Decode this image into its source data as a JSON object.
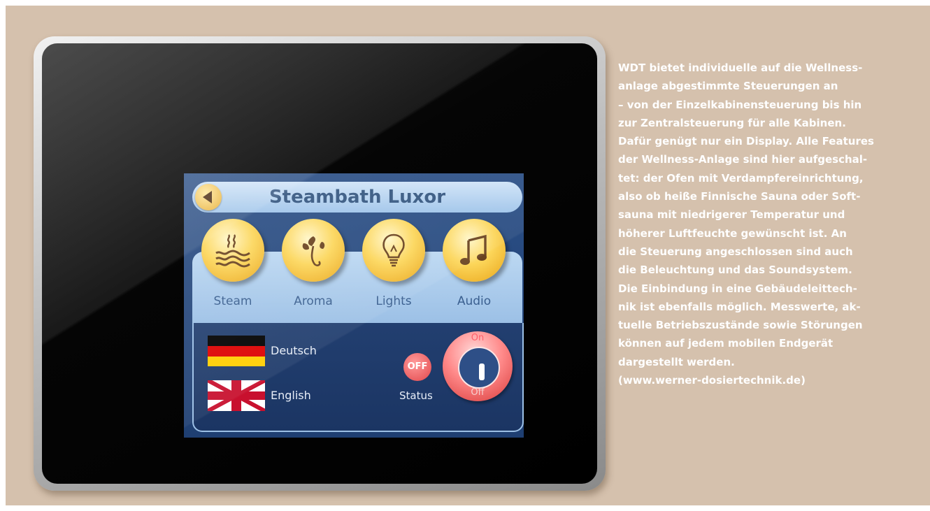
{
  "device": {
    "title": "Steambath Luxor",
    "features": [
      {
        "label": "Steam",
        "icon": "steam-icon"
      },
      {
        "label": "Aroma",
        "icon": "aroma-icon"
      },
      {
        "label": "Lights",
        "icon": "lightbulb-icon"
      },
      {
        "label": "Audio",
        "icon": "music-icon"
      }
    ],
    "languages": [
      {
        "label": "Deutsch",
        "icon": "german-flag-icon"
      },
      {
        "label": "English",
        "icon": "uk-flag-icon"
      }
    ],
    "status_badge": "OFF",
    "status_label": "Status",
    "power": {
      "on_label": "On",
      "off_label": "Off",
      "icon": "power-icon"
    }
  },
  "article": {
    "lines": [
      "WDT bietet individuelle auf die Wellness-",
      "anlage abgestimmte Steuerungen an",
      "– von der Einzelkabinensteuerung bis hin",
      "zur Zentralsteuerung für alle Kabinen.",
      "Dafür genügt nur ein Display. Alle Features",
      "der Wellness-Anlage sind hier aufgeschal-",
      "tet: der Ofen mit Verdampfereinrichtung,",
      "also ob heiße Finnische Sauna oder Soft-",
      "sauna mit niedrigerer Temperatur und",
      "höherer Luftfeuchte gewünscht ist. An",
      "die Steuerung angeschlossen sind auch",
      "die Beleuchtung und das Soundsystem.",
      "Die Einbindung in eine Gebäudeleittech-",
      "nik ist ebenfalls möglich. Messwerte, ak-",
      "tuelle Betriebszustände sowie Störungen",
      "können auf jedem mobilen Endgerät",
      "dargestellt werden.",
      "(www.werner-dosiertechnik.de)"
    ]
  }
}
